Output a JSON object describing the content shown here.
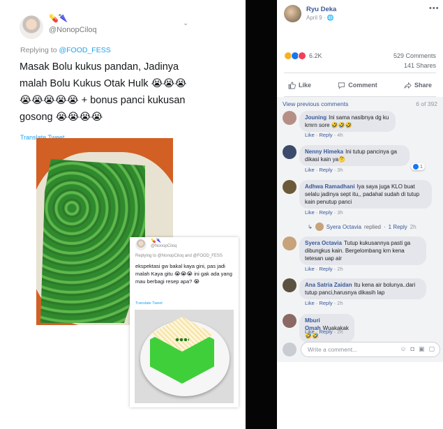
{
  "tweet": {
    "emoji": "💊🌂",
    "handle": "@NonopCiloq",
    "reply_prefix": "Replying to",
    "reply_to": "@FOOD_FESS",
    "text": "Masak Bolu kukus pandan, Jadinya malah Bolu Kukus Otak Hulk 😭😭😭 😭😭😭😭😭 + bonus panci kukusan gosong 😭😭😭😭",
    "translate": "Translate Tweet"
  },
  "tweet2": {
    "emoji": "💊🌂",
    "handle": "@NonopCiloq",
    "reply": "Replying to @NonopCiloq and @FOOD_FESS",
    "text": "ekspektasi gw bakal kaya gini, pas jadi malah Kaya gitu 😭😭😭 ini gak ada yang mau berbagi resep apa? 😭",
    "translate": "Translate Tweet"
  },
  "post": {
    "author": "Ryu Deka",
    "date": "April 9 · 🌐",
    "menu": "•••",
    "reaction_count": "6.2K",
    "comments_count": "529 Comments",
    "shares_count": "141 Shares",
    "like_label": "Like",
    "comment_label": "Comment",
    "share_label": "Share"
  },
  "comments_section": {
    "view_previous": "View previous comments",
    "count": "6 of 392",
    "like": "Like",
    "reply": "Reply",
    "comments": [
      {
        "name": "Jouning",
        "text": "Ini sama nasibnya dg ku kmrn sore 🤣🤣🤣",
        "time": "4h",
        "avatar_color": "#b58f86"
      },
      {
        "name": "Nenny Himeka",
        "text": "Ini tutup pancinya ga dikasi kain ya🤔",
        "time": "3h",
        "avatar_color": "#3c4a6b",
        "badge": "1"
      },
      {
        "name": "Adhwa Ramadhani",
        "text": "Iya saya juga KLO buat selalu jadinya sept itu,, padahal sudah di tutup kain penutup panci",
        "time": "3h",
        "avatar_color": "#6b5a3a"
      },
      {
        "name": "Syera Octavia",
        "text": "Tutup kukusannya pasti ga dibungkus kain. Bergelombang krn kena tetesan uap air",
        "time": "2h",
        "avatar_color": "#c7a27a"
      },
      {
        "name": "Ana Satria Zaidan",
        "text": "Itu kena air bolunya..dari tutup panci,harusnya dikasih lap",
        "time": "2h",
        "avatar_color": "#5a5141"
      },
      {
        "name": "Mburi Omah",
        "text": "Wuakakak🤣🤣",
        "time": "2h",
        "avatar_color": "#8a6a63"
      }
    ],
    "reply_thread": {
      "name": "Syera Octavia",
      "text": "replied",
      "count": "1 Reply",
      "time": "2h"
    }
  },
  "composer": {
    "placeholder": "Write a comment...",
    "icons": [
      "smiley-icon",
      "camera-icon",
      "gif-icon",
      "sticker-icon"
    ]
  }
}
